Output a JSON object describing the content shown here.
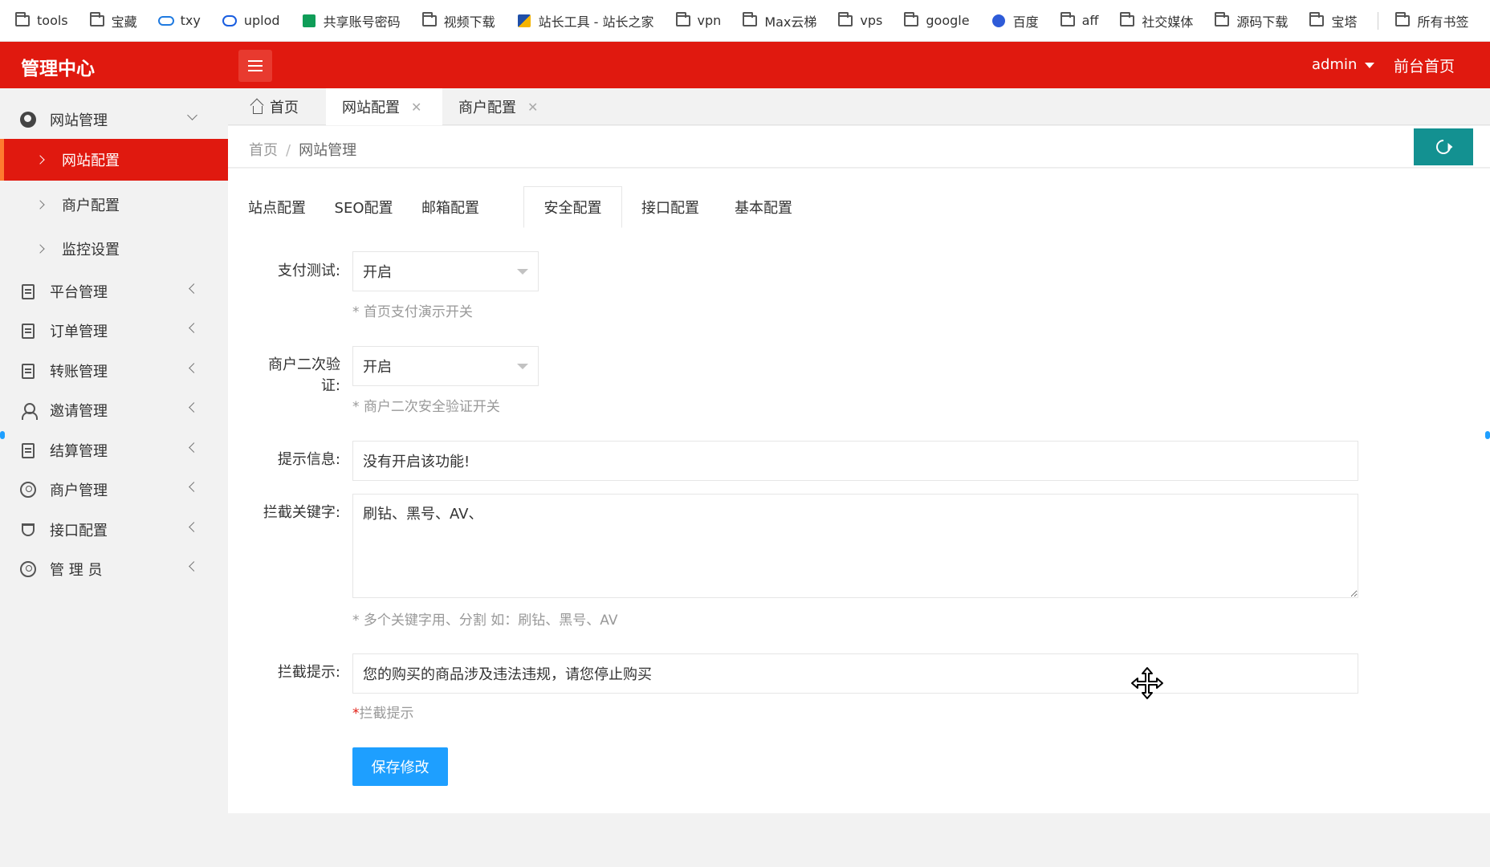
{
  "bookmarks": [
    {
      "label": "tools",
      "icon": "folder-icon"
    },
    {
      "label": "宝藏",
      "icon": "folder-icon"
    },
    {
      "label": "txy",
      "icon": "cloud-icon"
    },
    {
      "label": "uplod",
      "icon": "upload-icon"
    },
    {
      "label": "共享账号密码",
      "icon": "sheet-icon"
    },
    {
      "label": "视频下载",
      "icon": "folder-icon"
    },
    {
      "label": "站长工具 - 站长之家",
      "icon": "tool-icon"
    },
    {
      "label": "vpn",
      "icon": "folder-icon"
    },
    {
      "label": "Max云梯",
      "icon": "folder-icon"
    },
    {
      "label": "vps",
      "icon": "folder-icon"
    },
    {
      "label": "google",
      "icon": "folder-icon"
    },
    {
      "label": "百度",
      "icon": "paw-icon"
    },
    {
      "label": "aff",
      "icon": "folder-icon"
    },
    {
      "label": "社交媒体",
      "icon": "folder-icon"
    },
    {
      "label": "源码下载",
      "icon": "folder-icon"
    },
    {
      "label": "宝塔",
      "icon": "folder-icon"
    },
    {
      "label": "所有书签",
      "icon": "folder-icon"
    }
  ],
  "header": {
    "title": "管理中心",
    "user": "admin",
    "front_link": "前台首页",
    "accent": "#e0190f"
  },
  "sidebar": {
    "groups": [
      {
        "label": "网站管理",
        "icon": "globe-icon",
        "expanded": true,
        "children": [
          "网站配置",
          "商户配置",
          "监控设置"
        ],
        "active_child": "网站配置"
      },
      {
        "label": "平台管理",
        "icon": "document-icon"
      },
      {
        "label": "订单管理",
        "icon": "document-icon"
      },
      {
        "label": "转账管理",
        "icon": "document-icon"
      },
      {
        "label": "邀请管理",
        "icon": "user-icon"
      },
      {
        "label": "结算管理",
        "icon": "document-icon"
      },
      {
        "label": "商户管理",
        "icon": "user-circle-icon"
      },
      {
        "label": "接口配置",
        "icon": "plug-icon"
      },
      {
        "label": "管 理 员",
        "icon": "user-circle-icon"
      }
    ]
  },
  "page_tabs": [
    {
      "label": "首页",
      "closable": false
    },
    {
      "label": "网站配置",
      "closable": true,
      "active": true
    },
    {
      "label": "商户配置",
      "closable": true
    }
  ],
  "breadcrumb": [
    "首页",
    "网站管理"
  ],
  "config_tabs": [
    "站点配置",
    "SEO配置",
    "邮箱配置",
    "安全配置",
    "接口配置",
    "基本配置"
  ],
  "active_config_tab": "安全配置",
  "form": {
    "pay_test": {
      "label": "支付测试:",
      "value": "开启",
      "hint": "* 首页支付演示开关"
    },
    "merchant_verify": {
      "label": "商户二次验证:",
      "value": "开启",
      "hint": "* 商户二次安全验证开关"
    },
    "notice": {
      "label": "提示信息:",
      "value": "没有开启该功能!"
    },
    "block_keywords": {
      "label": "拦截关键字:",
      "value": "刷钻、黑号、AV、",
      "hint": "* 多个关键字用、分割 如：刷钻、黑号、AV"
    },
    "block_tip": {
      "label": "拦截提示:",
      "value": "您的购买的商品涉及违法违规，请您停止购买",
      "hint_star": "*",
      "hint": "拦截提示"
    },
    "save_label": "保存修改"
  },
  "colors": {
    "primary_btn": "#1e9fff",
    "refresh_btn": "#139191"
  }
}
